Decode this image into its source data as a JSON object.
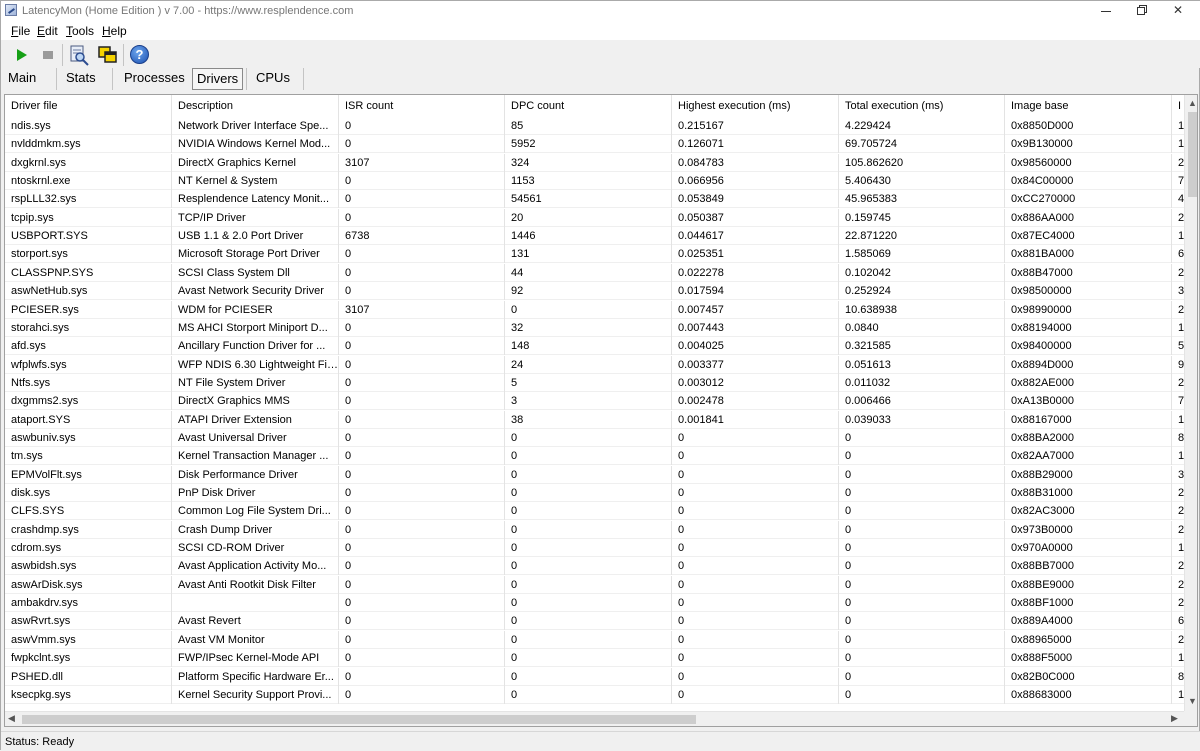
{
  "window": {
    "title": "LatencyMon  (Home Edition )  v 7.00 - https://www.resplendence.com",
    "minimize_glyph": "",
    "maximize_glyph": "",
    "close_glyph": "✕"
  },
  "menu": {
    "items": [
      {
        "label": "File",
        "accel": "F",
        "rest": "ile"
      },
      {
        "label": "Edit",
        "accel": "E",
        "rest": "dit"
      },
      {
        "label": "Tools",
        "accel": "T",
        "rest": "ools"
      },
      {
        "label": "Help",
        "accel": "H",
        "rest": "elp"
      }
    ]
  },
  "toolbar": {
    "icons": [
      "start-icon",
      "stop-icon",
      "analyze-icon",
      "window-icon",
      "help-icon"
    ],
    "help_glyph": "?",
    "accent_colors": {
      "start": "#16a016",
      "help": "#1a4fb0"
    }
  },
  "tabs": [
    {
      "label": "Main"
    },
    {
      "label": "Stats"
    },
    {
      "label": "Processes"
    },
    {
      "label": "Drivers",
      "active": true
    },
    {
      "label": "CPUs"
    }
  ],
  "table": {
    "columns": [
      "Driver file",
      "Description",
      "ISR count",
      "DPC count",
      "Highest execution (ms)",
      "Total execution (ms)",
      "Image base",
      "I"
    ],
    "rows": [
      [
        "ndis.sys",
        "Network Driver Interface Spe...",
        "0",
        "85",
        "0.215167",
        "4.229424",
        "0x8850D000",
        "1"
      ],
      [
        "nvlddmkm.sys",
        "NVIDIA Windows Kernel Mod...",
        "0",
        "5952",
        "0.126071",
        "69.705724",
        "0x9B130000",
        "1"
      ],
      [
        "dxgkrnl.sys",
        "DirectX Graphics Kernel",
        "3107",
        "324",
        "0.084783",
        "105.862620",
        "0x98560000",
        "2"
      ],
      [
        "ntoskrnl.exe",
        "NT Kernel & System",
        "0",
        "1153",
        "0.066956",
        "5.406430",
        "0x84C00000",
        "7"
      ],
      [
        "rspLLL32.sys",
        "Resplendence Latency Monit...",
        "0",
        "54561",
        "0.053849",
        "45.965383",
        "0xCC270000",
        "4"
      ],
      [
        "tcpip.sys",
        "TCP/IP Driver",
        "0",
        "20",
        "0.050387",
        "0.159745",
        "0x886AA000",
        "2"
      ],
      [
        "USBPORT.SYS",
        "USB 1.1 & 2.0 Port Driver",
        "6738",
        "1446",
        "0.044617",
        "22.871220",
        "0x87EC4000",
        "1"
      ],
      [
        "storport.sys",
        "Microsoft Storage Port Driver",
        "0",
        "131",
        "0.025351",
        "1.585069",
        "0x881BA000",
        "6"
      ],
      [
        "CLASSPNP.SYS",
        "SCSI Class System Dll",
        "0",
        "44",
        "0.022278",
        "0.102042",
        "0x88B47000",
        "2"
      ],
      [
        "aswNetHub.sys",
        "Avast Network Security Driver",
        "0",
        "92",
        "0.017594",
        "0.252924",
        "0x98500000",
        "3"
      ],
      [
        "PCIESER.sys",
        "WDM for PCIESER",
        "3107",
        "0",
        "0.007457",
        "10.638938",
        "0x98990000",
        "2"
      ],
      [
        "storahci.sys",
        "MS AHCI Storport Miniport D...",
        "0",
        "32",
        "0.007443",
        "0.0840",
        "0x88194000",
        "1"
      ],
      [
        "afd.sys",
        "Ancillary Function Driver for ...",
        "0",
        "148",
        "0.004025",
        "0.321585",
        "0x98400000",
        "5"
      ],
      [
        "wfplwfs.sys",
        "WFP NDIS 6.30 Lightweight Fil...",
        "0",
        "24",
        "0.003377",
        "0.051613",
        "0x8894D000",
        "9"
      ],
      [
        "Ntfs.sys",
        "NT File System Driver",
        "0",
        "5",
        "0.003012",
        "0.011032",
        "0x882AE000",
        "2"
      ],
      [
        "dxgmms2.sys",
        "DirectX Graphics MMS",
        "0",
        "3",
        "0.002478",
        "0.006466",
        "0xA13B0000",
        "7"
      ],
      [
        "ataport.SYS",
        "ATAPI Driver Extension",
        "0",
        "38",
        "0.001841",
        "0.039033",
        "0x88167000",
        "1"
      ],
      [
        "aswbuniv.sys",
        "Avast Universal Driver",
        "0",
        "0",
        "0",
        "0",
        "0x88BA2000",
        "8"
      ],
      [
        "tm.sys",
        "Kernel Transaction Manager ...",
        "0",
        "0",
        "0",
        "0",
        "0x82AA7000",
        "1"
      ],
      [
        "EPMVolFlt.sys",
        "Disk Performance Driver",
        "0",
        "0",
        "0",
        "0",
        "0x88B29000",
        "3"
      ],
      [
        "disk.sys",
        "PnP Disk Driver",
        "0",
        "0",
        "0",
        "0",
        "0x88B31000",
        "2"
      ],
      [
        "CLFS.SYS",
        "Common Log File System Dri...",
        "0",
        "0",
        "0",
        "0",
        "0x82AC3000",
        "2"
      ],
      [
        "crashdmp.sys",
        "Crash Dump Driver",
        "0",
        "0",
        "0",
        "0",
        "0x973B0000",
        "2"
      ],
      [
        "cdrom.sys",
        "SCSI CD-ROM Driver",
        "0",
        "0",
        "0",
        "0",
        "0x970A0000",
        "1"
      ],
      [
        "aswbidsh.sys",
        "Avast Application Activity Mo...",
        "0",
        "0",
        "0",
        "0",
        "0x88BB7000",
        "2"
      ],
      [
        "aswArDisk.sys",
        "Avast Anti Rootkit Disk Filter",
        "0",
        "0",
        "0",
        "0",
        "0x88BE9000",
        "2"
      ],
      [
        "ambakdrv.sys",
        "",
        "0",
        "0",
        "0",
        "0",
        "0x88BF1000",
        "2"
      ],
      [
        "aswRvrt.sys",
        "Avast Revert",
        "0",
        "0",
        "0",
        "0",
        "0x889A4000",
        "6"
      ],
      [
        "aswVmm.sys",
        "Avast VM Monitor",
        "0",
        "0",
        "0",
        "0",
        "0x88965000",
        "2"
      ],
      [
        "fwpkclnt.sys",
        "FWP/IPsec Kernel-Mode API",
        "0",
        "0",
        "0",
        "0",
        "0x888F5000",
        "1"
      ],
      [
        "PSHED.dll",
        "Platform Specific Hardware Er...",
        "0",
        "0",
        "0",
        "0",
        "0x82B0C000",
        "8"
      ],
      [
        "ksecpkg.sys",
        "Kernel Security Support Provi...",
        "0",
        "0",
        "0",
        "0",
        "0x88683000",
        "1"
      ]
    ]
  },
  "scrollbars": {
    "up": "▲",
    "down": "▼",
    "left": "◀",
    "right": "▶"
  },
  "status": {
    "text": "Status: Ready"
  }
}
